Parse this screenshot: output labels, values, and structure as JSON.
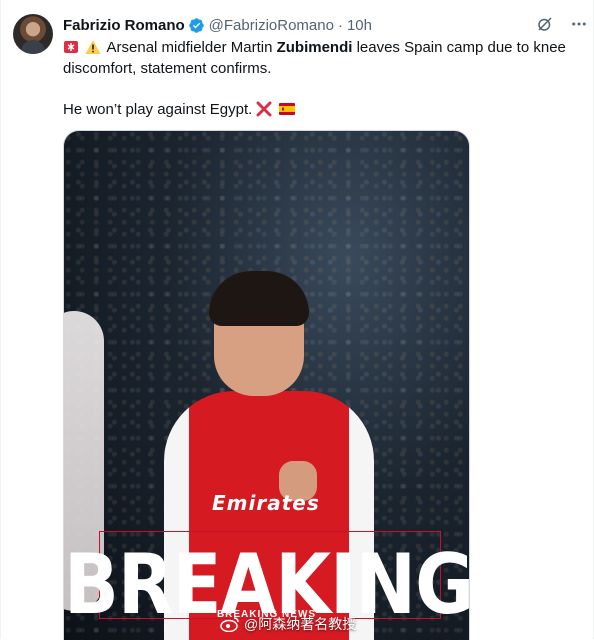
{
  "tweet": {
    "author": {
      "name": "Fabrizio Romano",
      "handle": "@FabrizioRomano",
      "separator": "·",
      "time": "10h",
      "verified_color": "#1d9bf0"
    },
    "actions": {
      "grok_icon": "grok-icon",
      "more_icon": "more-icon"
    },
    "text": {
      "line1_pre": "Arsenal midfielder Martin ",
      "line1_bold": "Zubimendi",
      "line1_post": " leaves Spain camp due to knee discomfort, statement confirms.",
      "line2": "He won’t play against Egypt."
    },
    "emojis": [
      "rotating-light-emoji",
      "warning-emoji",
      "cross-mark-emoji",
      "spain-flag-emoji"
    ],
    "media": {
      "headline": "BREAKING",
      "subheadline": "BREAKING NEWS",
      "sponsor": "Emirates",
      "watermark": "@阿森纳著名教授",
      "accent_color": "#c8102e"
    }
  }
}
